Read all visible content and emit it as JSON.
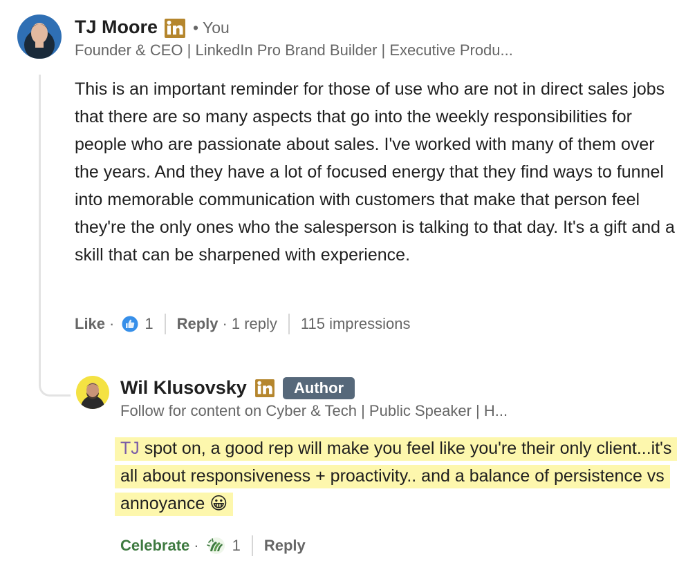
{
  "comments": [
    {
      "author": "TJ Moore",
      "relation": "• You",
      "headline": "Founder & CEO | LinkedIn Pro Brand Builder | Executive Produ...",
      "body": "This is an important reminder for those of use who are not in direct sales jobs that there are so many aspects that go into the weekly responsibilities for people who are passionate about sales. I've worked with many of them over the years. And they have a lot of focused energy that they find ways to funnel into memorable communication with customers that make that person feel they're the only ones who the salesperson is talking to that day. It's a gift and a skill that can be sharpened with experience.",
      "actions": {
        "like_label": "Like",
        "reaction_icon": "like-icon",
        "reaction_count": "1",
        "reply_label": "Reply",
        "reply_count": "1 reply",
        "impressions": "115 impressions"
      }
    },
    {
      "author": "Wil Klusovsky",
      "badge": "Author",
      "headline": "Follow for content on Cyber & Tech | Public Speaker | H...",
      "mention": "TJ",
      "body": " spot on, a good rep will make you feel like you're their only client...it's all about responsiveness + proactivity.. and a balance of persistence vs annoyance",
      "emoji": "😀",
      "actions": {
        "celebrate_label": "Celebrate",
        "reaction_icon": "celebrate-icon",
        "reaction_count": "1",
        "reply_label": "Reply"
      }
    }
  ],
  "icons": {
    "premium_badge": "linkedin-premium-icon"
  },
  "colors": {
    "premium_gold": "#b5862d",
    "highlight": "#fdf7ad",
    "mention": "#7b5ea7",
    "like_blue": "#378fe9",
    "celebrate_green": "#3e7a40",
    "badge_bg": "#56687a"
  }
}
